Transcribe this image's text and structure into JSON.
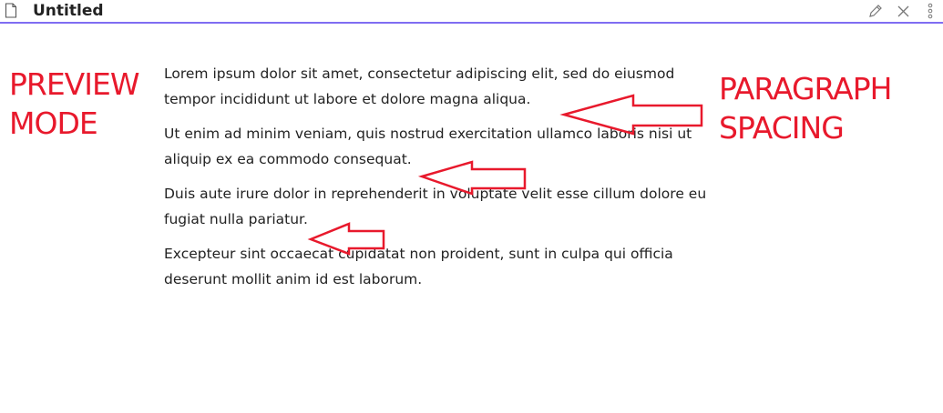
{
  "window": {
    "title": "Untitled",
    "file_icon": "file-icon",
    "edit_icon": "pencil-icon",
    "close_icon": "close-icon",
    "more_icon": "more-vertical-icon"
  },
  "content": {
    "paragraphs": [
      {
        "line1": "Lorem ipsum dolor sit amet, consectetur adipiscing elit, sed do eiusmod",
        "line2": "tempor incididunt ut labore et dolore magna aliqua."
      },
      {
        "line1": "Ut enim ad minim veniam, quis nostrud exercitation ullamco laboris nisi ut",
        "line2": "aliquip ex ea commodo consequat."
      },
      {
        "line1": "Duis aute irure dolor in reprehenderit in voluptate velit esse cillum dolore eu",
        "line2": "fugiat nulla pariatur."
      },
      {
        "line1": "Excepteur sint occaecat cupidatat non proident, sunt in culpa qui officia",
        "line2": "deserunt mollit anim id est laborum."
      }
    ]
  },
  "annotations": {
    "left_line1": "PREVIEW",
    "left_line2": "MODE",
    "right_line1": "PARAGRAPH",
    "right_line2": "SPACING",
    "color": "#e8192c"
  },
  "theme": {
    "accent": "#7f6df2"
  }
}
